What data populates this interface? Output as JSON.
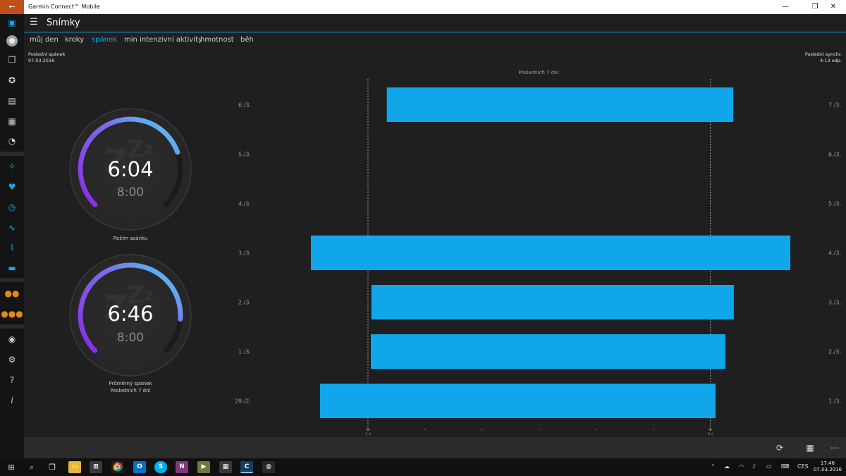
{
  "window": {
    "title": "Garmin Connect™ Mobile",
    "back_icon": "←",
    "minimize": "—",
    "maximize": "❐",
    "close": "✕"
  },
  "header": {
    "menu_icon": "☰",
    "page_title": "Snímky"
  },
  "tabs": [
    "můj den",
    "kroky",
    "spánek",
    "min intenzivní aktivity",
    "hmotnost",
    "běh"
  ],
  "active_tab": "spánek",
  "last_sleep": {
    "label": "Poslední spánek",
    "date": "07.03.2016"
  },
  "last_sync": {
    "label": "Poslední synchr.",
    "time": "4:13 odp."
  },
  "gauges": [
    {
      "value": "6:04",
      "goal": "8:00",
      "label_line1": "Režim spánku",
      "label_line2": "",
      "progress": 0.76
    },
    {
      "value": "6:46",
      "goal": "8:00",
      "label_line1": "Průměrný spánek",
      "label_line2": "Posledních 7 dní",
      "progress": 0.85
    }
  ],
  "colors": {
    "accent": "#19a7e6",
    "bar": "#10a7ea",
    "arc_start": "#8a2be2",
    "arc_end": "#4dd6f2",
    "titlebar_back": "#bf4f16"
  },
  "chart_data": {
    "type": "bar",
    "orientation": "horizontal",
    "title": "Posledních 7 dní",
    "left_labels": [
      "6./3.",
      "5./3.",
      "4./3.",
      "3./3.",
      "2./3.",
      "1./3.",
      "29./2."
    ],
    "right_labels": [
      "7./3.",
      "6./3.",
      "5./3.",
      "4./3.",
      "3./3.",
      "2./3.",
      "1./3."
    ],
    "x_ticks": [
      "2 d",
      "8 d"
    ],
    "series": [
      {
        "values_start": [
          1.33,
          null,
          null,
          0.0,
          1.06,
          1.05,
          0.16
        ],
        "values_end": [
          7.4,
          null,
          null,
          8.4,
          7.41,
          7.26,
          7.09
        ]
      }
    ],
    "xlim": [
      0,
      8.4
    ],
    "reference_lines": [
      1.0,
      7.0
    ]
  },
  "command_bar": {
    "refresh_icon": "⟳",
    "grid_icon": "▦",
    "more_icon": "⋯"
  },
  "taskbar": {
    "start_icon": "⊞",
    "search_icon": "⌕",
    "task_view_icon": "❐",
    "language": "CES",
    "time": "17:46",
    "date": "07.03.2016"
  }
}
